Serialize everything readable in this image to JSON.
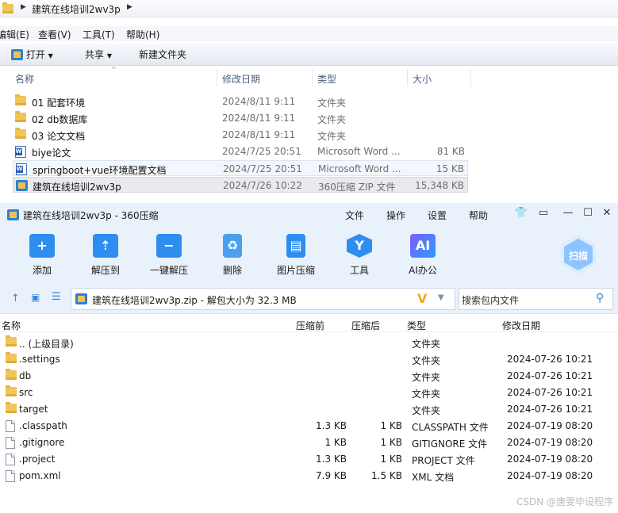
{
  "explorer": {
    "path": "建筑在线培训2wv3p",
    "menu": [
      "编辑(E)",
      "查看(V)",
      "工具(T)",
      "帮助(H)"
    ],
    "toolbar": {
      "open": "打开",
      "share": "共享",
      "new_folder": "新建文件夹"
    },
    "columns": {
      "name": "名称",
      "date": "修改日期",
      "type": "类型",
      "size": "大小"
    },
    "files": [
      {
        "name": "01 配套环境",
        "date": "2024/8/11 9:11",
        "type": "文件夹",
        "size": "",
        "icon": "folder-icon"
      },
      {
        "name": "02 db数据库",
        "date": "2024/8/11 9:11",
        "type": "文件夹",
        "size": "",
        "icon": "folder-icon"
      },
      {
        "name": "03 论文文档",
        "date": "2024/8/11 9:11",
        "type": "文件夹",
        "size": "",
        "icon": "folder-icon"
      },
      {
        "name": "biye论文",
        "date": "2024/7/25 20:51",
        "type": "Microsoft Word ...",
        "size": "81 KB",
        "icon": "word-icon"
      },
      {
        "name": "springboot+vue环境配置文档",
        "date": "2024/7/25 20:51",
        "type": "Microsoft Word ...",
        "size": "15 KB",
        "icon": "word-icon"
      },
      {
        "name": "建筑在线培训2wv3p",
        "date": "2024/7/26 10:22",
        "type": "360压缩 ZIP 文件",
        "size": "15,348 KB",
        "icon": "zip-icon"
      }
    ]
  },
  "zip": {
    "title": "建筑在线培训2wv3p - 360压缩",
    "menu": [
      "文件",
      "操作",
      "设置",
      "帮助"
    ],
    "tools": [
      "添加",
      "解压到",
      "一键解压",
      "删除",
      "图片压缩",
      "工具",
      "AI办公"
    ],
    "scan": "扫描",
    "address": "建筑在线培训2wv3p.zip - 解包大小为 32.3 MB",
    "search_placeholder": "搜索包内文件",
    "columns": {
      "name": "名称",
      "compressed": "压缩前",
      "uncompressed": "压缩后",
      "type": "类型",
      "date": "修改日期"
    },
    "files": [
      {
        "name": ".. (上级目录)",
        "compressed": "",
        "uncompressed": "",
        "type": "文件夹",
        "date": "",
        "icon": "folder-icon"
      },
      {
        "name": ".settings",
        "compressed": "",
        "uncompressed": "",
        "type": "文件夹",
        "date": "2024-07-26 10:21",
        "icon": "folder-icon"
      },
      {
        "name": "db",
        "compressed": "",
        "uncompressed": "",
        "type": "文件夹",
        "date": "2024-07-26 10:21",
        "icon": "folder-icon"
      },
      {
        "name": "src",
        "compressed": "",
        "uncompressed": "",
        "type": "文件夹",
        "date": "2024-07-26 10:21",
        "icon": "folder-icon"
      },
      {
        "name": "target",
        "compressed": "",
        "uncompressed": "",
        "type": "文件夹",
        "date": "2024-07-26 10:21",
        "icon": "folder-icon"
      },
      {
        "name": ".classpath",
        "compressed": "1.3 KB",
        "uncompressed": "1 KB",
        "type": "CLASSPATH 文件",
        "date": "2024-07-19 08:20",
        "icon": "file-icon"
      },
      {
        "name": ".gitignore",
        "compressed": "1 KB",
        "uncompressed": "1 KB",
        "type": "GITIGNORE 文件",
        "date": "2024-07-19 08:20",
        "icon": "file-icon"
      },
      {
        "name": ".project",
        "compressed": "1.3 KB",
        "uncompressed": "1 KB",
        "type": "PROJECT 文件",
        "date": "2024-07-19 08:20",
        "icon": "file-icon"
      },
      {
        "name": "pom.xml",
        "compressed": "7.9 KB",
        "uncompressed": "1.5 KB",
        "type": "XML 文档",
        "date": "2024-07-19 08:20",
        "icon": "file-icon"
      }
    ]
  },
  "watermark": "CSDN @唐雯毕设程序"
}
